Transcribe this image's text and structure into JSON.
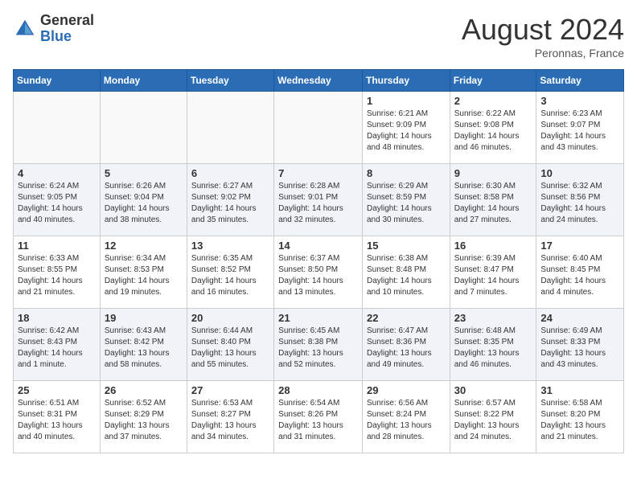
{
  "logo": {
    "general": "General",
    "blue": "Blue"
  },
  "title": {
    "month_year": "August 2024",
    "location": "Peronnas, France"
  },
  "weekdays": [
    "Sunday",
    "Monday",
    "Tuesday",
    "Wednesday",
    "Thursday",
    "Friday",
    "Saturday"
  ],
  "weeks": [
    [
      {
        "day": "",
        "info": ""
      },
      {
        "day": "",
        "info": ""
      },
      {
        "day": "",
        "info": ""
      },
      {
        "day": "",
        "info": ""
      },
      {
        "day": "1",
        "info": "Sunrise: 6:21 AM\nSunset: 9:09 PM\nDaylight: 14 hours and 48 minutes."
      },
      {
        "day": "2",
        "info": "Sunrise: 6:22 AM\nSunset: 9:08 PM\nDaylight: 14 hours and 46 minutes."
      },
      {
        "day": "3",
        "info": "Sunrise: 6:23 AM\nSunset: 9:07 PM\nDaylight: 14 hours and 43 minutes."
      }
    ],
    [
      {
        "day": "4",
        "info": "Sunrise: 6:24 AM\nSunset: 9:05 PM\nDaylight: 14 hours and 40 minutes."
      },
      {
        "day": "5",
        "info": "Sunrise: 6:26 AM\nSunset: 9:04 PM\nDaylight: 14 hours and 38 minutes."
      },
      {
        "day": "6",
        "info": "Sunrise: 6:27 AM\nSunset: 9:02 PM\nDaylight: 14 hours and 35 minutes."
      },
      {
        "day": "7",
        "info": "Sunrise: 6:28 AM\nSunset: 9:01 PM\nDaylight: 14 hours and 32 minutes."
      },
      {
        "day": "8",
        "info": "Sunrise: 6:29 AM\nSunset: 8:59 PM\nDaylight: 14 hours and 30 minutes."
      },
      {
        "day": "9",
        "info": "Sunrise: 6:30 AM\nSunset: 8:58 PM\nDaylight: 14 hours and 27 minutes."
      },
      {
        "day": "10",
        "info": "Sunrise: 6:32 AM\nSunset: 8:56 PM\nDaylight: 14 hours and 24 minutes."
      }
    ],
    [
      {
        "day": "11",
        "info": "Sunrise: 6:33 AM\nSunset: 8:55 PM\nDaylight: 14 hours and 21 minutes."
      },
      {
        "day": "12",
        "info": "Sunrise: 6:34 AM\nSunset: 8:53 PM\nDaylight: 14 hours and 19 minutes."
      },
      {
        "day": "13",
        "info": "Sunrise: 6:35 AM\nSunset: 8:52 PM\nDaylight: 14 hours and 16 minutes."
      },
      {
        "day": "14",
        "info": "Sunrise: 6:37 AM\nSunset: 8:50 PM\nDaylight: 14 hours and 13 minutes."
      },
      {
        "day": "15",
        "info": "Sunrise: 6:38 AM\nSunset: 8:48 PM\nDaylight: 14 hours and 10 minutes."
      },
      {
        "day": "16",
        "info": "Sunrise: 6:39 AM\nSunset: 8:47 PM\nDaylight: 14 hours and 7 minutes."
      },
      {
        "day": "17",
        "info": "Sunrise: 6:40 AM\nSunset: 8:45 PM\nDaylight: 14 hours and 4 minutes."
      }
    ],
    [
      {
        "day": "18",
        "info": "Sunrise: 6:42 AM\nSunset: 8:43 PM\nDaylight: 14 hours and 1 minute."
      },
      {
        "day": "19",
        "info": "Sunrise: 6:43 AM\nSunset: 8:42 PM\nDaylight: 13 hours and 58 minutes."
      },
      {
        "day": "20",
        "info": "Sunrise: 6:44 AM\nSunset: 8:40 PM\nDaylight: 13 hours and 55 minutes."
      },
      {
        "day": "21",
        "info": "Sunrise: 6:45 AM\nSunset: 8:38 PM\nDaylight: 13 hours and 52 minutes."
      },
      {
        "day": "22",
        "info": "Sunrise: 6:47 AM\nSunset: 8:36 PM\nDaylight: 13 hours and 49 minutes."
      },
      {
        "day": "23",
        "info": "Sunrise: 6:48 AM\nSunset: 8:35 PM\nDaylight: 13 hours and 46 minutes."
      },
      {
        "day": "24",
        "info": "Sunrise: 6:49 AM\nSunset: 8:33 PM\nDaylight: 13 hours and 43 minutes."
      }
    ],
    [
      {
        "day": "25",
        "info": "Sunrise: 6:51 AM\nSunset: 8:31 PM\nDaylight: 13 hours and 40 minutes."
      },
      {
        "day": "26",
        "info": "Sunrise: 6:52 AM\nSunset: 8:29 PM\nDaylight: 13 hours and 37 minutes."
      },
      {
        "day": "27",
        "info": "Sunrise: 6:53 AM\nSunset: 8:27 PM\nDaylight: 13 hours and 34 minutes."
      },
      {
        "day": "28",
        "info": "Sunrise: 6:54 AM\nSunset: 8:26 PM\nDaylight: 13 hours and 31 minutes."
      },
      {
        "day": "29",
        "info": "Sunrise: 6:56 AM\nSunset: 8:24 PM\nDaylight: 13 hours and 28 minutes."
      },
      {
        "day": "30",
        "info": "Sunrise: 6:57 AM\nSunset: 8:22 PM\nDaylight: 13 hours and 24 minutes."
      },
      {
        "day": "31",
        "info": "Sunrise: 6:58 AM\nSunset: 8:20 PM\nDaylight: 13 hours and 21 minutes."
      }
    ]
  ]
}
